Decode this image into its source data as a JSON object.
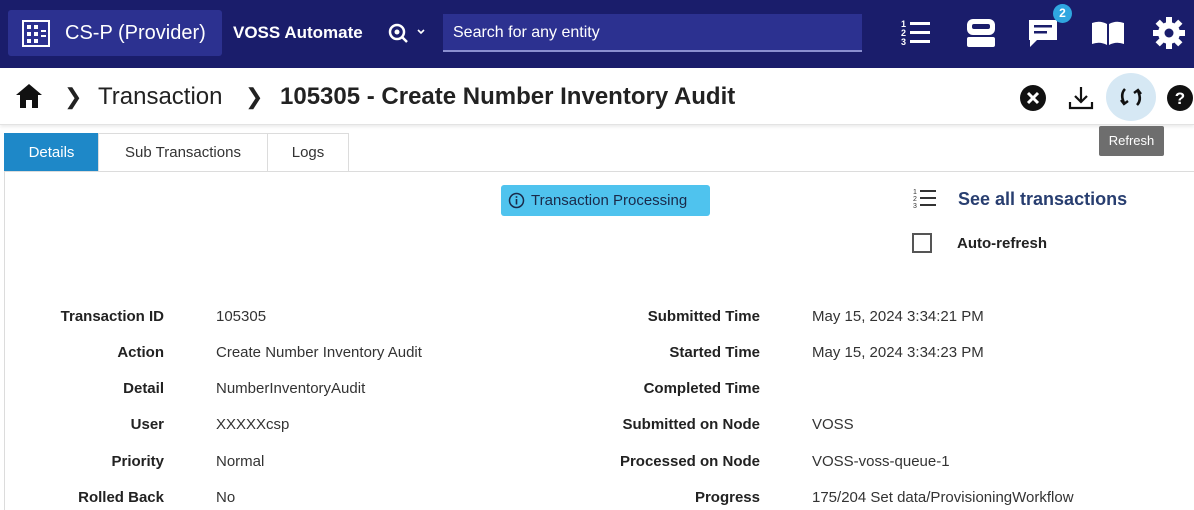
{
  "topbar": {
    "tenant": "CS-P (Provider)",
    "product": "VOSS Automate",
    "search_placeholder": "Search for any entity",
    "notification_count": "2",
    "icons": [
      "building-icon",
      "search-scope-icon",
      "menu-list-icon",
      "robot-icon",
      "message-icon",
      "book-icon",
      "gear-icon"
    ]
  },
  "breadcrumb": {
    "parent": "Transaction",
    "current": "105305 - Create Number Inventory Audit"
  },
  "actions": {
    "refresh_tooltip": "Refresh"
  },
  "tabs": [
    {
      "label": "Details",
      "active": true
    },
    {
      "label": "Sub Transactions",
      "active": false
    },
    {
      "label": "Logs",
      "active": false
    }
  ],
  "status": {
    "label": "Transaction Processing",
    "color": "#4fc3ee"
  },
  "links": {
    "see_all": "See all transactions",
    "auto_refresh": "Auto-refresh",
    "auto_refresh_checked": false
  },
  "details_left": [
    {
      "label": "Transaction ID",
      "value": "105305"
    },
    {
      "label": "Action",
      "value": "Create Number Inventory Audit"
    },
    {
      "label": "Detail",
      "value": "NumberInventoryAudit"
    },
    {
      "label": "User",
      "value": "XXXXXcsp"
    },
    {
      "label": "Priority",
      "value": "Normal"
    },
    {
      "label": "Rolled Back",
      "value": "No"
    }
  ],
  "details_right": [
    {
      "label": "Submitted Time",
      "value": "May 15, 2024 3:34:21 PM"
    },
    {
      "label": "Started Time",
      "value": "May 15, 2024 3:34:23 PM"
    },
    {
      "label": "Completed Time",
      "value": ""
    },
    {
      "label": "Submitted on Node",
      "value": "VOSS"
    },
    {
      "label": "Processed on Node",
      "value": "VOSS-voss-queue-1"
    },
    {
      "label": "Progress",
      "value": "175/204 Set data/ProvisioningWorkflow"
    }
  ],
  "colors": {
    "navbar": "#1a1d6b",
    "tenant_bg": "#2c3190",
    "tab_active": "#1e88c8",
    "link": "#283e70"
  }
}
